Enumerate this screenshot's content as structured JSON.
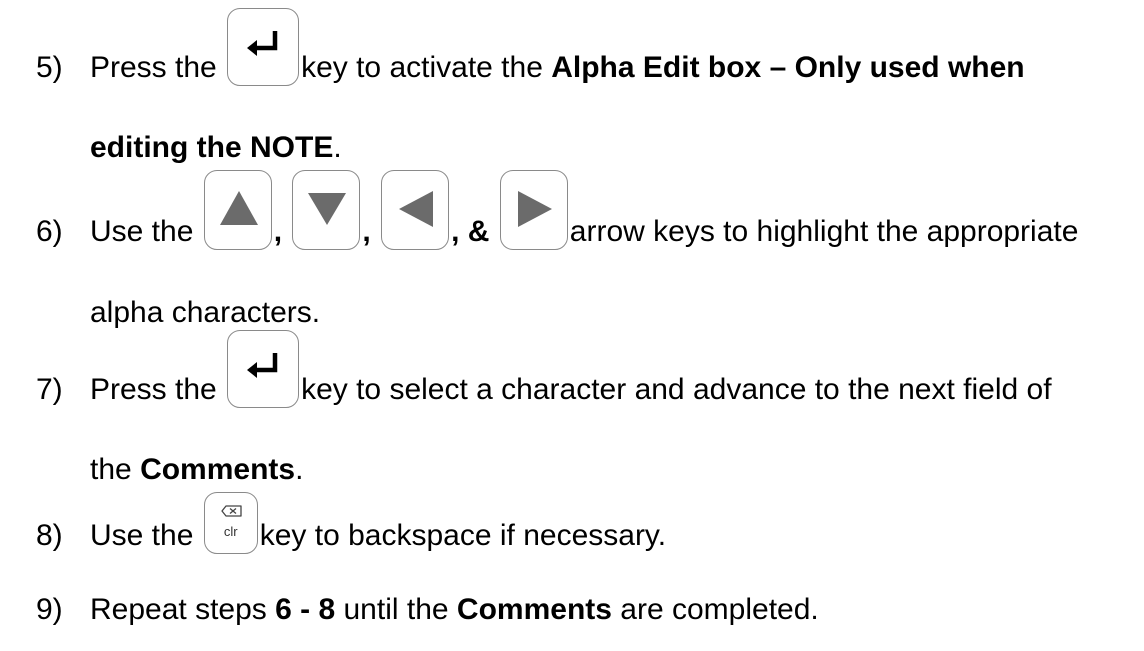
{
  "steps": {
    "s5": {
      "num": "5)",
      "pre": "Press the",
      "key_icon": "enter-key-icon",
      "mid": "key to activate the",
      "bold1": "Alpha Edit box – Only used when",
      "bold2": "editing the NOTE",
      "end": "."
    },
    "s6": {
      "num": "6)",
      "pre": "Use the",
      "key_icons": [
        "up-arrow-key-icon",
        "down-arrow-key-icon",
        "left-arrow-key-icon",
        "right-arrow-key-icon"
      ],
      "comma": ",",
      "amp": ", &",
      "mid": "arrow keys to highlight the appropriate",
      "cont": "alpha characters."
    },
    "s7": {
      "num": "7)",
      "pre": "Press the",
      "key_icon": "enter-key-icon",
      "mid": "key to select a character and advance to the next field of",
      "cont_pre": "the",
      "bold": "Comments",
      "end": "."
    },
    "s8": {
      "num": "8)",
      "pre": "Use the",
      "key_icon": "backspace-clr-key-icon",
      "key_label": "clr",
      "mid": "key to backspace if necessary."
    },
    "s9": {
      "num": "9)",
      "pre": "Repeat steps",
      "bold1": "6 - 8",
      "mid": "until the",
      "bold2": "Comments",
      "end": "are completed."
    }
  },
  "colors": {
    "text": "#000000",
    "key_border": "#8a8a8a",
    "key_glyph": "#000000",
    "arrow_glyph": "#6b6b6b"
  }
}
